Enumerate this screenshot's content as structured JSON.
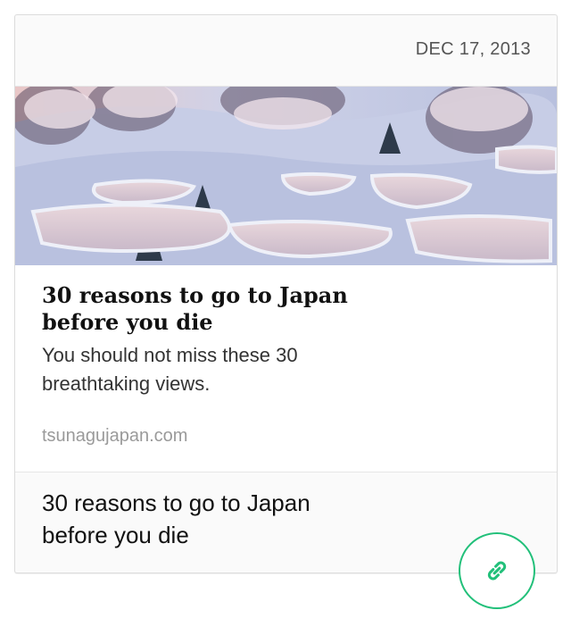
{
  "post": {
    "date": "DEC 17, 2013",
    "comment": "30 reasons to go to Japan before you die"
  },
  "preview": {
    "image_alt": "Snowy terraced rice fields in Japan",
    "title": "30 reasons to go to Japan before you die",
    "description": "You should not miss these 30 breathtaking views.",
    "domain": "tsunagujapan.com"
  },
  "actions": {
    "link_icon": "link-icon"
  },
  "colors": {
    "accent": "#22c07a",
    "card_bg": "#fafafa",
    "border": "#dcdcdc"
  }
}
